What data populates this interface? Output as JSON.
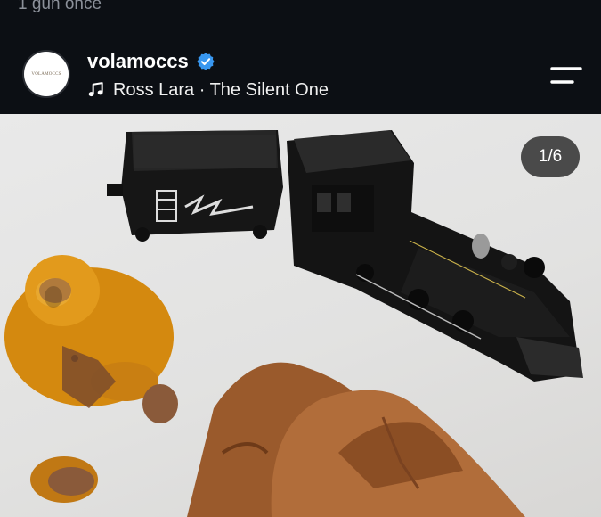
{
  "previous_post": {
    "caption_tail": "1 gün önce"
  },
  "post": {
    "username": "volamoccs",
    "verified": true,
    "avatar_brand_text": "VOLAMOCCS",
    "music": {
      "artist": "Ross Lara",
      "separator": " · ",
      "track": "The Silent One"
    },
    "media": {
      "counter": "1/6",
      "current_index": 1,
      "total": 6
    }
  },
  "colors": {
    "background": "#0c0f14",
    "verified_badge": "#3897f0",
    "counter_pill": "#282828"
  },
  "icons": {
    "verified": "verified-badge-icon",
    "music": "music-note-icon",
    "menu": "menu-icon"
  }
}
